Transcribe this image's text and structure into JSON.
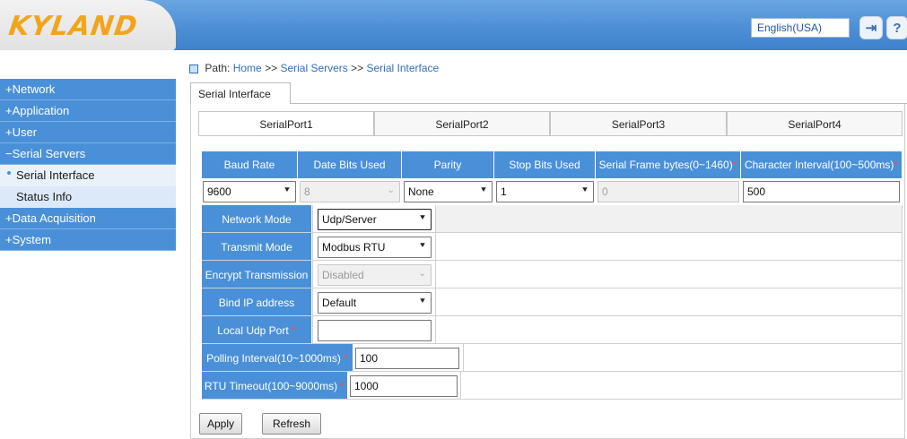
{
  "header": {
    "logo": "KYLAND",
    "language": "English(USA)"
  },
  "sidebar": {
    "items": [
      {
        "label": "+Network"
      },
      {
        "label": "+Application"
      },
      {
        "label": "+User"
      },
      {
        "label": "−Serial Servers"
      },
      {
        "label": "Serial Interface"
      },
      {
        "label": "Status Info"
      },
      {
        "label": "+Data Acquisition"
      },
      {
        "label": "+System"
      }
    ]
  },
  "breadcrumb": {
    "prefix": "Path:",
    "home": "Home",
    "sep1": ">>",
    "level1": "Serial Servers",
    "sep2": ">>",
    "level2": "Serial Interface"
  },
  "page_tab": "Serial Interface",
  "port_tabs": [
    "SerialPort1",
    "SerialPort2",
    "SerialPort3",
    "SerialPort4"
  ],
  "columns": [
    {
      "label": "Baud Rate",
      "required": ""
    },
    {
      "label": "Date Bits Used",
      "required": ""
    },
    {
      "label": "Parity",
      "required": ""
    },
    {
      "label": "Stop Bits Used",
      "required": ""
    },
    {
      "label": "Serial Frame bytes(0~1460)",
      "required": "*"
    },
    {
      "label": "Character Interval(100~500ms)",
      "required": "*"
    }
  ],
  "values": {
    "baud_rate": "9600",
    "data_bits": "8",
    "parity": "None",
    "stop_bits": "1",
    "frame_bytes": "0",
    "char_interval": "500"
  },
  "settings": {
    "network_mode": {
      "label": "Network Mode",
      "value": "Udp/Server"
    },
    "transmit_mode": {
      "label": "Transmit Mode",
      "value": "Modbus RTU"
    },
    "encrypt": {
      "label": "Encrypt Transmission",
      "value": "Disabled"
    },
    "bind_ip": {
      "label": "Bind IP address",
      "value": "Default"
    },
    "local_udp_port": {
      "label": "Local Udp Port",
      "required": "*",
      "value": ""
    },
    "polling_interval": {
      "label": "Polling Interval(10~1000ms)",
      "required": "*",
      "value": "100"
    },
    "rtu_timeout": {
      "label": "RTU Timeout(100~9000ms)",
      "required": "*",
      "value": "1000"
    }
  },
  "buttons": {
    "apply": "Apply",
    "refresh": "Refresh"
  },
  "colors": {
    "accent": "#4a90d9",
    "logo": "#f2a51c",
    "required": "#ff4d4d"
  }
}
